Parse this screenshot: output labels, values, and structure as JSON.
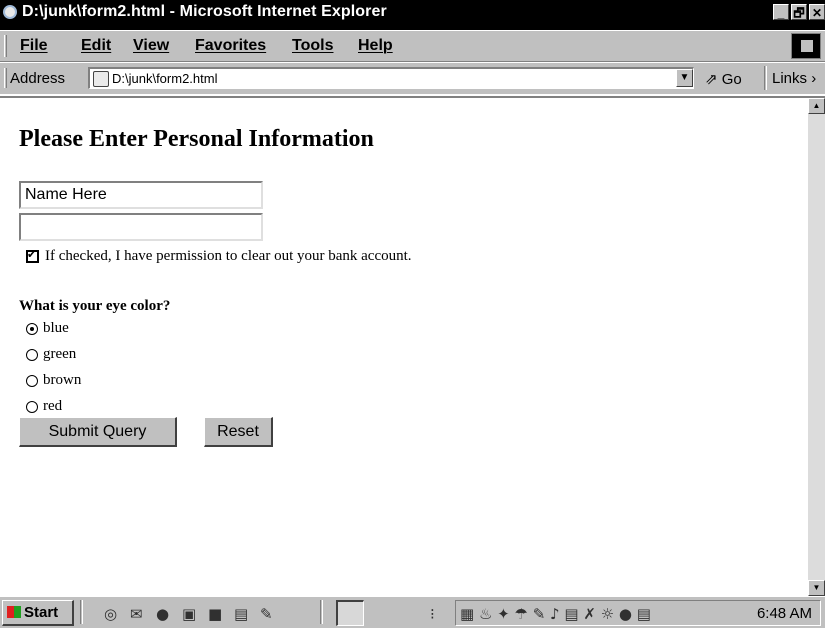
{
  "window": {
    "title": "D:\\junk\\form2.html - Microsoft Internet Explorer",
    "controls": [
      "_",
      "🗗",
      "✕"
    ]
  },
  "menu": [
    {
      "label": "File"
    },
    {
      "label": "Edit"
    },
    {
      "label": "View"
    },
    {
      "label": "Favorites"
    },
    {
      "label": "Tools"
    },
    {
      "label": "Help"
    }
  ],
  "address_bar": {
    "label": "Address",
    "value": "D:\\junk\\form2.html",
    "go_label": "Go",
    "links_label": "Links"
  },
  "page": {
    "heading": "Please Enter Personal Information",
    "name_field": {
      "value": "Name Here"
    },
    "second_field": {
      "value": ""
    },
    "permission": {
      "checked": true,
      "label": "If checked, I have permission to clear out your bank account."
    },
    "eye_question": "What is your eye color?",
    "eye_options": [
      {
        "label": "blue",
        "selected": true
      },
      {
        "label": "green",
        "selected": false
      },
      {
        "label": "brown",
        "selected": false
      },
      {
        "label": "red",
        "selected": false
      }
    ],
    "submit_label": "Submit Query",
    "reset_label": "Reset"
  },
  "taskbar": {
    "start_label": "Start",
    "clock": "6:48 AM"
  }
}
